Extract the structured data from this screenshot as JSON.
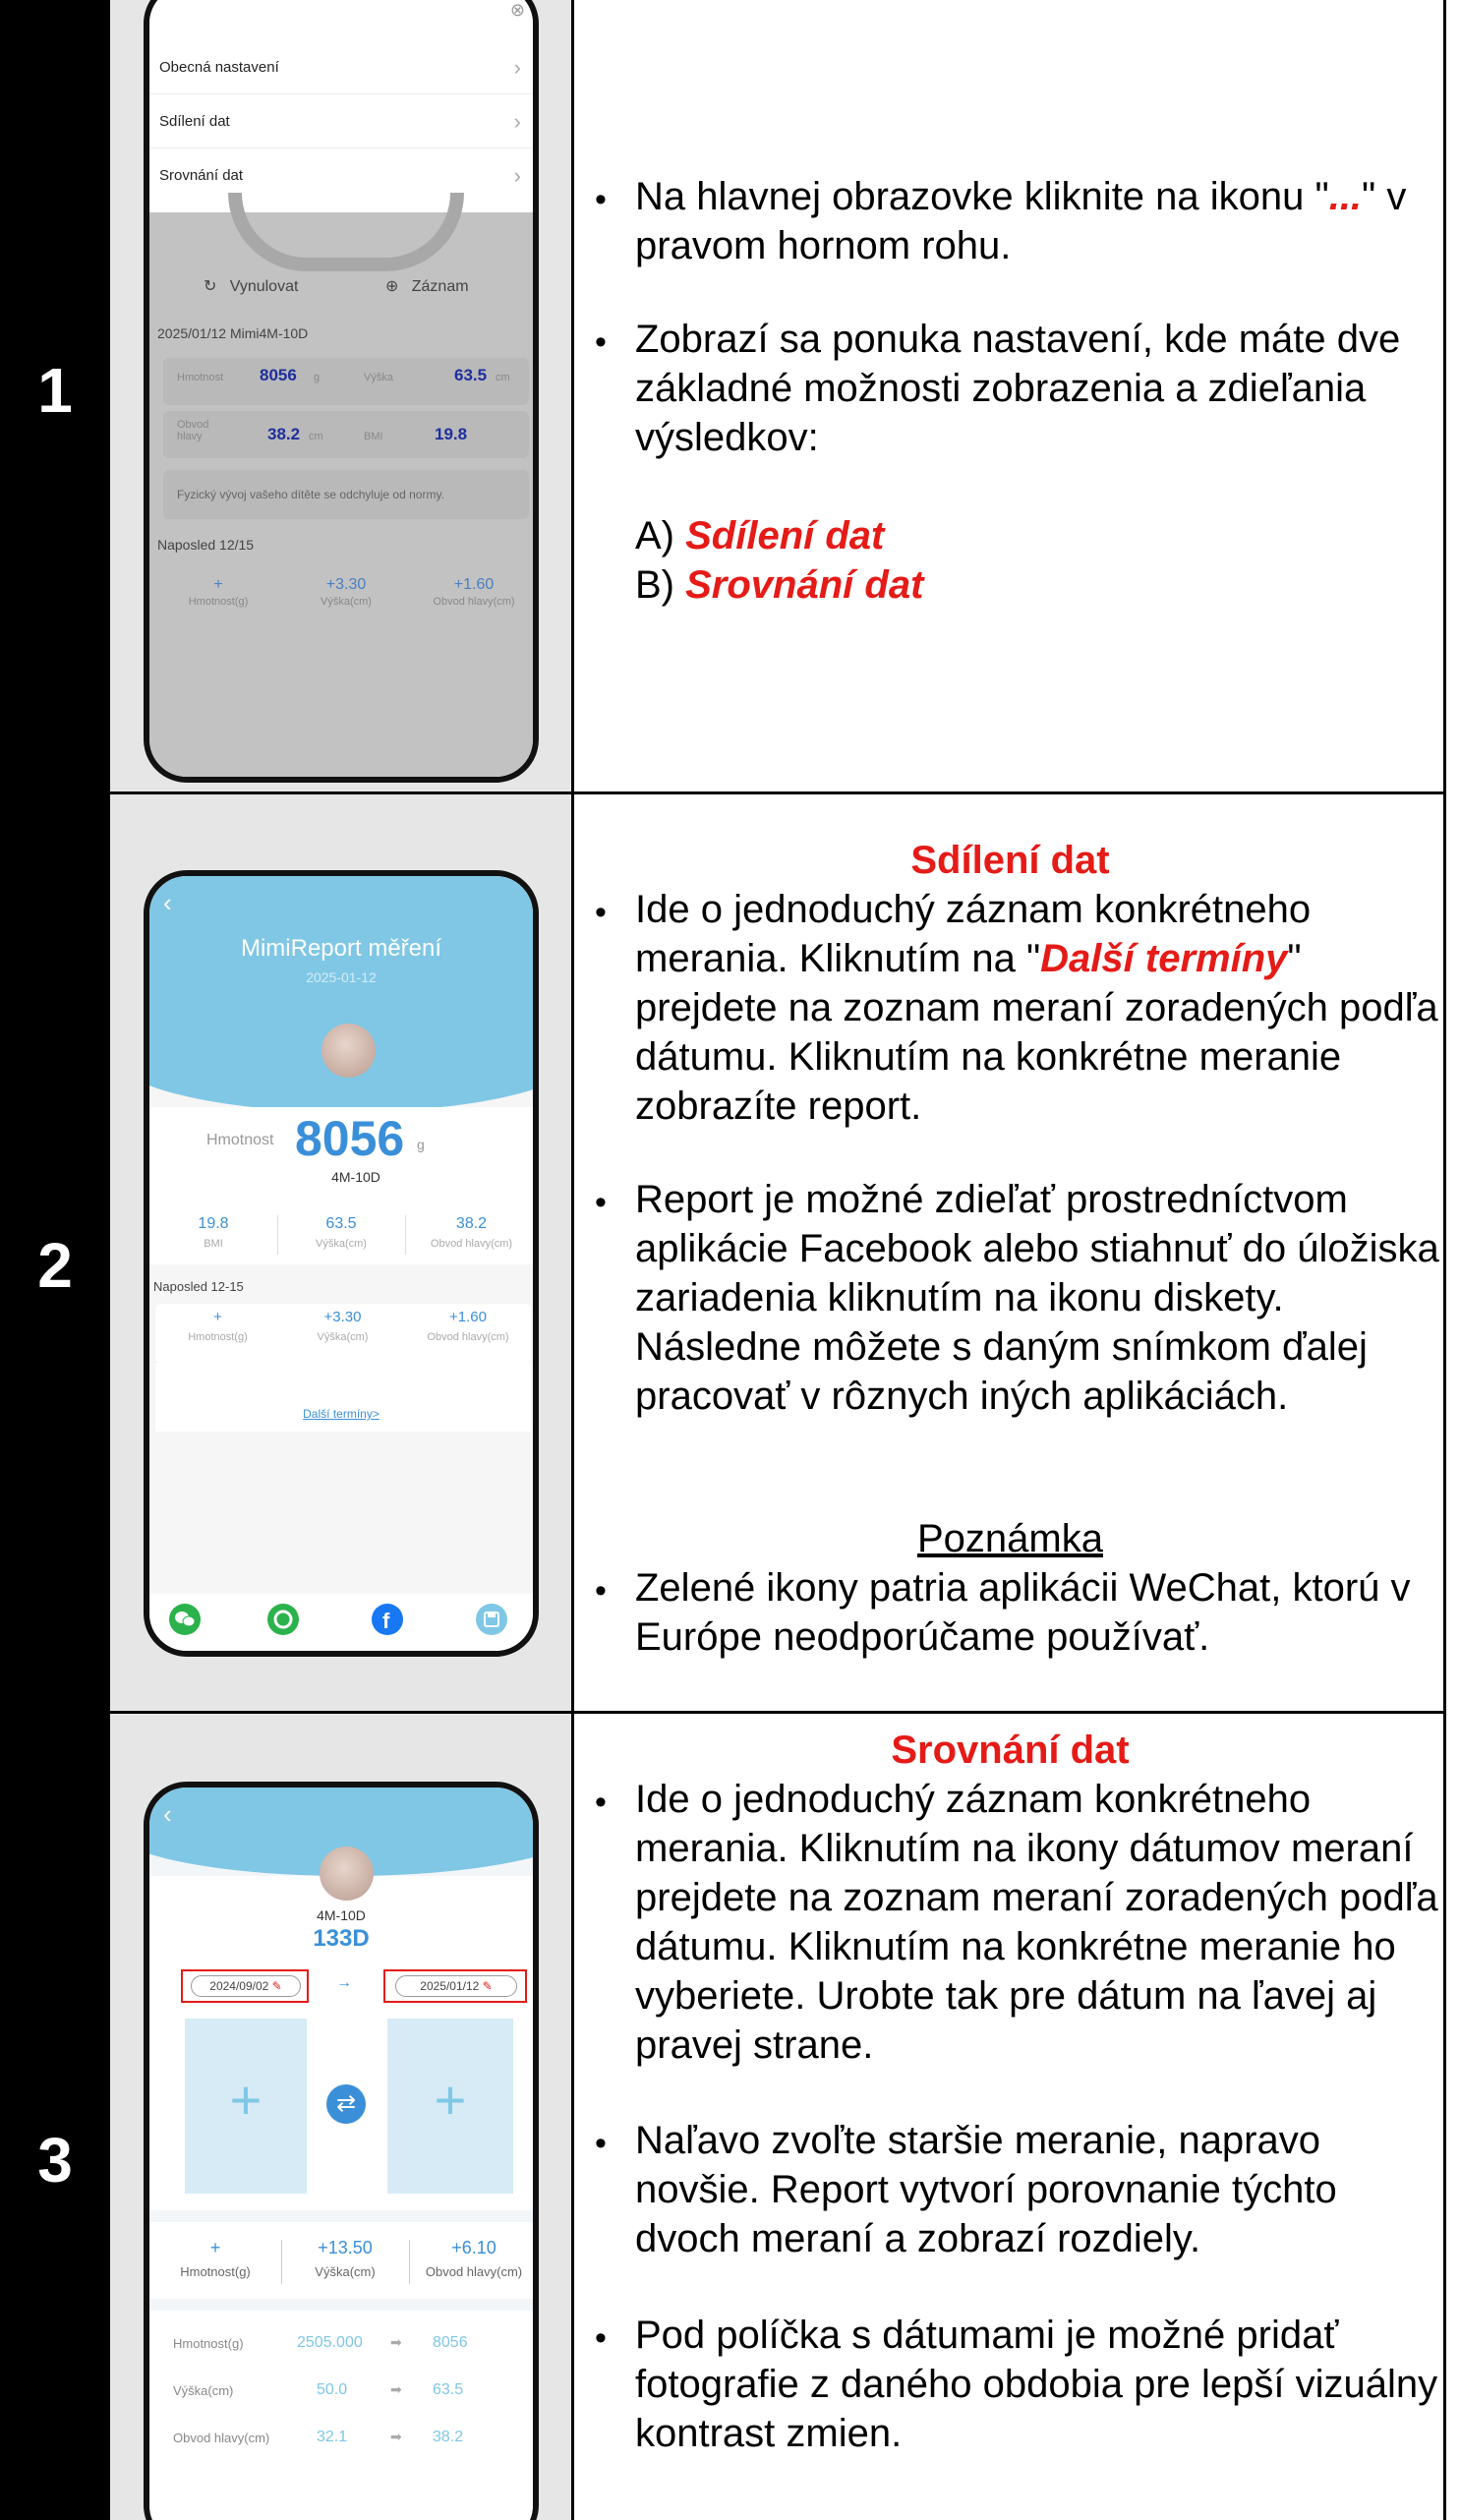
{
  "steps": [
    {
      "number": "1",
      "bullets": [
        {
          "pre": "Na hlavnej obrazovke kliknite na ikonu \"",
          "em": "...",
          "post": "\" v pravom hornom rohu."
        },
        {
          "text": "Zobrazí sa ponuka nastavení, kde máte dve základné možnosti zobrazenia a zdieľania výsledkov:"
        }
      ],
      "options": [
        {
          "prefix": "A) ",
          "label": "Sdílení dat"
        },
        {
          "prefix": "B) ",
          "label": "Srovnání dat"
        }
      ]
    },
    {
      "number": "2",
      "heading": "Sdílení dat",
      "bullet1": {
        "pre": "Ide o jednoduchý záznam konkrétneho merania. Kliknutím na \"",
        "em": "Další termíny",
        "post": "\" prejdete na zoznam meraní zoradených podľa dátumu. Kliknutím na konkrétne meranie zobrazíte report."
      },
      "bullet2": "Report je možné zdieľať prostredníctvom aplikácie Facebook alebo stiahnuť do úložiska zariadenia kliknutím na ikonu diskety. Následne môžete s daným snímkom ďalej pracovať v rôznych iných aplikáciách.",
      "note_heading": "Poznámka",
      "bullet3": "Zelené ikony patria aplikácii WeChat, ktorú v Európe neodporúčame používať."
    },
    {
      "number": "3",
      "heading": "Srovnání dat",
      "bullet1": "Ide o jednoduchý záznam konkrétneho merania. Kliknutím na ikony dátumov meraní prejdete na zoznam meraní zoradených podľa dátumu. Kliknutím na konkrétne meranie ho vyberiete. Urobte tak pre dátum na ľavej aj pravej strane.",
      "bullet2": "Naľavo zvoľte staršie meranie, napravo novšie. Report vytvorí porovnanie týchto dvoch meraní a zobrazí rozdiely.",
      "bullet3": "Pod políčka s dátumami je možné pridať fotografie z daného obdobia pre lepší vizuálny kontrast zmien."
    }
  ],
  "phone1": {
    "menu": [
      "Obecná nastavení",
      "Sdílení dat",
      "Srovnání dat"
    ],
    "reset": "Vynulovat",
    "record": "Záznam",
    "record_line": "2025/01/12  Mimi4M-10D",
    "weight_label": "Hmotnost",
    "weight": "8056",
    "weight_unit": "g",
    "height_label": "Výška",
    "height": "63.5",
    "height_unit": "cm",
    "head_label": "Obvod hlavy",
    "head": "38.2",
    "head_unit": "cm",
    "bmi_label": "BMI",
    "bmi": "19.8",
    "warning": "Fyzický vývoj vašeho dítěte se odchyluje od normy.",
    "last": "Naposled  12/15",
    "d1": "+",
    "d1_label": "Hmotnost(g)",
    "d2": "+3.30",
    "d2_label": "Výška(cm)",
    "d3": "+1.60",
    "d3_label": "Obvod hlavy(cm)"
  },
  "phone2": {
    "title": "MimiReport měření",
    "date": "2025-01-12",
    "weight_label": "Hmotnost",
    "weight": "8056",
    "unit": "g",
    "age": "4M-10D",
    "stats": [
      {
        "v": "19.8",
        "l": "BMI"
      },
      {
        "v": "63.5",
        "l": "Výška(cm)"
      },
      {
        "v": "38.2",
        "l": "Obvod hlavy(cm)"
      }
    ],
    "last": "Naposled  12-15",
    "deltas": [
      {
        "v": "+",
        "l": "Hmotnost(g)"
      },
      {
        "v": "+3.30",
        "l": "Výška(cm)"
      },
      {
        "v": "+1.60",
        "l": "Obvod hlavy(cm)"
      }
    ],
    "more": "Další termíny>"
  },
  "phone3": {
    "age": "4M-10D",
    "days": "133D",
    "date_left": "2024/09/02",
    "date_right": "2025/01/12",
    "deltas": [
      {
        "v": "+",
        "l": "Hmotnost(g)"
      },
      {
        "v": "+13.50",
        "l": "Výška(cm)"
      },
      {
        "v": "+6.10",
        "l": "Obvod hlavy(cm)"
      }
    ],
    "rows": [
      {
        "l": "Hmotnost(g)",
        "a": "2505.000",
        "b": "8056"
      },
      {
        "l": "Výška(cm)",
        "a": "50.0",
        "b": "63.5"
      },
      {
        "l": "Obvod hlavy(cm)",
        "a": "32.1",
        "b": "38.2"
      }
    ]
  },
  "colors": {
    "accent_red": "#e41b17",
    "header_blue": "#7fc7e5",
    "value_blue": "#3a8fd8"
  }
}
